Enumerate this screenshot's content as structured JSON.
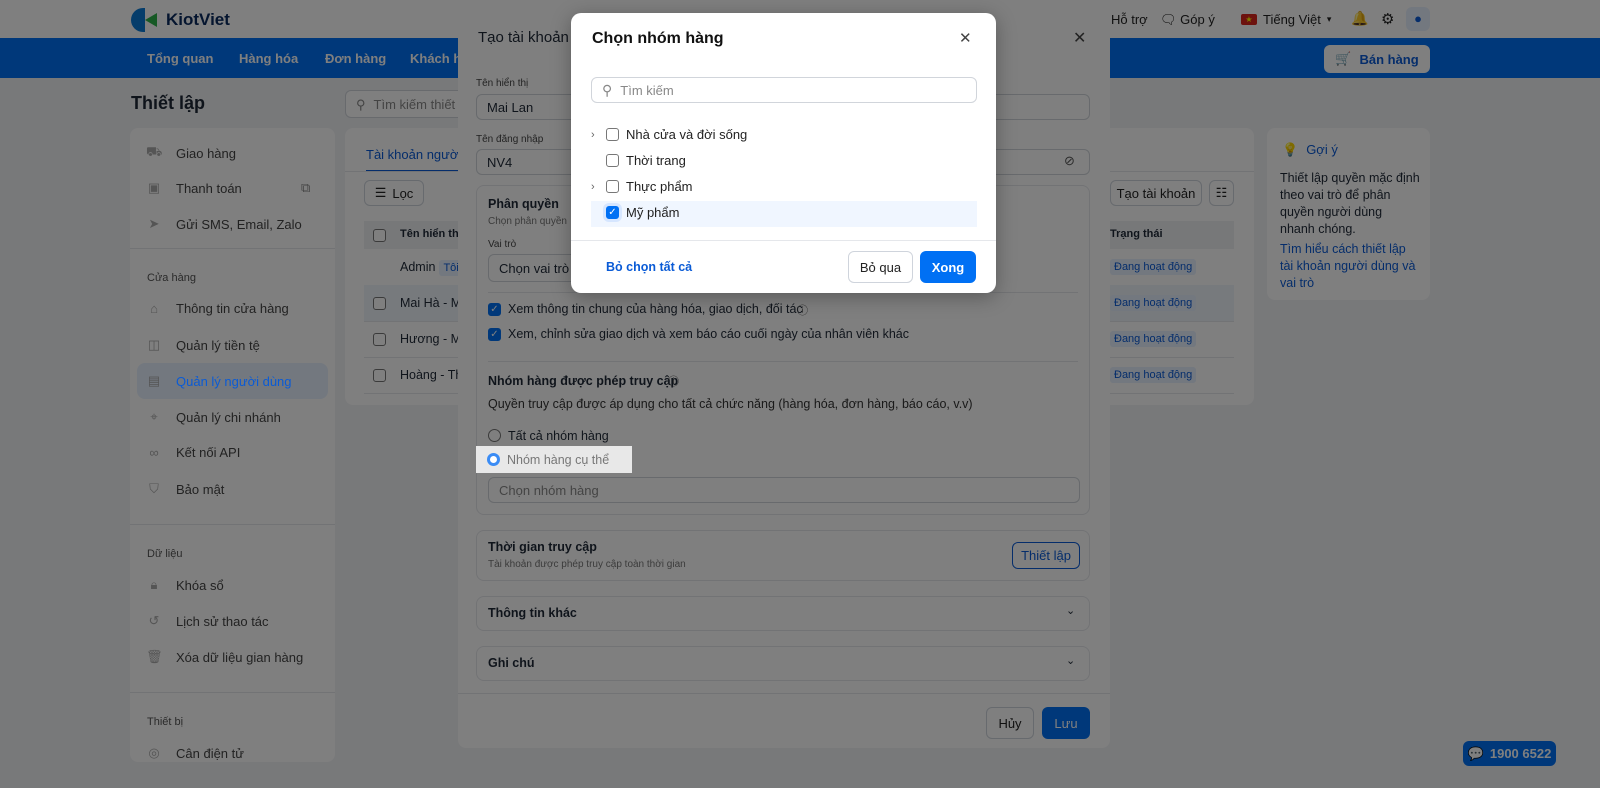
{
  "header": {
    "logo": "KiotViet",
    "support": "Hỗ trợ",
    "feedback": "Góp ý",
    "language": "Tiếng Việt",
    "sell_button": "Bán hàng"
  },
  "nav": [
    "Tổng quan",
    "Hàng hóa",
    "Đơn hàng",
    "Khách hàng"
  ],
  "page": {
    "title": "Thiết lập",
    "search_placeholder": "Tìm kiếm thiết lập"
  },
  "sidebar": {
    "top": [
      {
        "icon": "truck-icon",
        "label": "Giao hàng"
      },
      {
        "icon": "payment-icon",
        "label": "Thanh toán"
      },
      {
        "icon": "send-icon",
        "label": "Gửi SMS, Email, Zalo"
      }
    ],
    "sections": [
      {
        "title": "Cửa hàng",
        "items": [
          {
            "icon": "store-icon",
            "label": "Thông tin cửa hàng"
          },
          {
            "icon": "money-icon",
            "label": "Quản lý tiền tệ"
          },
          {
            "icon": "user-card-icon",
            "label": "Quản lý người dùng",
            "active": true
          },
          {
            "icon": "location-icon",
            "label": "Quản lý chi nhánh"
          },
          {
            "icon": "link-icon",
            "label": "Kết nối API"
          },
          {
            "icon": "shield-icon",
            "label": "Bảo mật"
          }
        ]
      },
      {
        "title": "Dữ liệu",
        "items": [
          {
            "icon": "lock-icon",
            "label": "Khóa sổ"
          },
          {
            "icon": "history-icon",
            "label": "Lịch sử thao tác"
          },
          {
            "icon": "trash-icon",
            "label": "Xóa dữ liệu gian hàng"
          }
        ]
      },
      {
        "title": "Thiết bị",
        "items": [
          {
            "icon": "scale-icon",
            "label": "Cân điện tử"
          }
        ]
      }
    ]
  },
  "main": {
    "tab": "Tài khoản người dùng",
    "filter": "Lọc",
    "create": "Tạo tài khoản",
    "col_name": "Tên hiển thị",
    "col_status": "Trạng thái",
    "rows": [
      {
        "name": "Admin",
        "tag": "Tôi",
        "status": "Đang hoạt động"
      },
      {
        "name": "Mai Hà - M",
        "status": "Đang hoạt động"
      },
      {
        "name": "Hương - M",
        "status": "Đang hoạt động"
      },
      {
        "name": "Hoàng - Th",
        "status": "Đang hoạt động"
      }
    ]
  },
  "tip": {
    "title": "Gợi ý",
    "text": "Thiết lập quyền mặc định theo vai trò để phân quyền người dùng nhanh chóng.",
    "link": "Tìm hiểu cách thiết lập tài khoản người dùng và vai trò"
  },
  "create_modal": {
    "title": "Tạo tài khoản",
    "display_name_label": "Tên hiển thị",
    "display_name": "Mai Lan",
    "username_label": "Tên đăng nhập",
    "username": "NV4",
    "perm_title": "Phân quyền",
    "perm_sub": "Chọn phân quyền",
    "role_label": "Vai trò",
    "role_placeholder": "Chọn vai trò",
    "check1": "Xem thông tin chung của hàng hóa, giao dịch, đối tác",
    "check2": "Xem, chỉnh sửa giao dịch và xem báo cáo cuối ngày của nhân viên khác",
    "group_title": "Nhóm hàng được phép truy cập",
    "group_desc": "Quyền truy cập được áp dụng cho tất cả chức năng (hàng hóa, đơn hàng, báo cáo, v.v)",
    "radio_all": "Tất cả nhóm hàng",
    "radio_specific": "Nhóm hàng cụ thể",
    "group_placeholder": "Chọn nhóm hàng",
    "time_title": "Thời gian truy cập",
    "time_sub": "Tài khoản được phép truy cập toàn thời gian",
    "time_button": "Thiết lập",
    "other": "Thông tin khác",
    "note": "Ghi chú",
    "cancel": "Hủy",
    "save": "Lưu"
  },
  "group_modal": {
    "title": "Chọn nhóm hàng",
    "search_placeholder": "Tìm kiếm",
    "options": [
      {
        "label": "Nhà cửa và đời sống",
        "expandable": true,
        "checked": false
      },
      {
        "label": "Thời trang",
        "expandable": false,
        "checked": false
      },
      {
        "label": "Thực phẩm",
        "expandable": true,
        "checked": false
      },
      {
        "label": "Mỹ phẩm",
        "expandable": false,
        "checked": true
      }
    ],
    "deselect_all": "Bỏ chọn tất cả",
    "skip": "Bỏ qua",
    "done": "Xong"
  },
  "hotline": "1900 6522",
  "colors": {
    "brand": "#0070f4",
    "overlay": "rgba(0,0,0,0.5)"
  }
}
